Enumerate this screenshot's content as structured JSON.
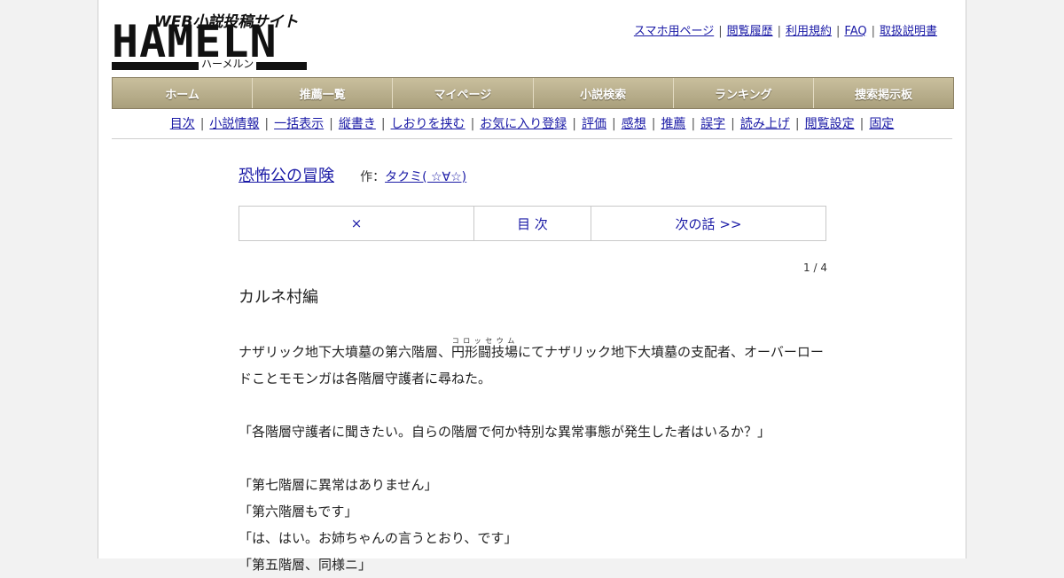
{
  "logo": {
    "tagline": "WEB小説投稿サイト",
    "wordmark": "HAMELN",
    "kana": "ハーメルン"
  },
  "top_links": [
    "スマホ用ページ",
    "閲覧履歴",
    "利用規約",
    "FAQ",
    "取扱説明書"
  ],
  "menu": [
    "ホーム",
    "推薦一覧",
    "マイページ",
    "小説検索",
    "ランキング",
    "捜索掲示板"
  ],
  "subnav": [
    "目次",
    "小説情報",
    "一括表示",
    "縦書き",
    "しおりを挟む",
    "お気に入り登録",
    "評価",
    "感想",
    "推薦",
    "誤字",
    "読み上げ",
    "閲覧設定",
    "固定"
  ],
  "novel": {
    "title": "恐怖公の冒険",
    "author_label": "作：",
    "author": "タクミ( ☆∀☆)"
  },
  "pager": {
    "close": "×",
    "toc": "目 次",
    "next": "次の話 >>"
  },
  "page_count": "1 / 4",
  "chapter_title": "カルネ村編",
  "body": {
    "p1_a": "ナザリック地下大墳墓の第六階層、",
    "p1_ruby_base": "円形闘技場",
    "p1_ruby_text": "コロッセウム",
    "p1_b": "にてナザリック地下大墳墓の支配者、オーバーロードことモモンガは各階層守護者に尋ねた。",
    "p2": "「各階層守護者に聞きたい。自らの階層で何か特別な異常事態が発生した者はいるか？」",
    "p3": "「第七階層に異常はありません」",
    "p4": "「第六階層もです」",
    "p5": "「は、はい。お姉ちゃんの言うとおり、です」",
    "p6": "「第五階層、同様ニ」"
  }
}
